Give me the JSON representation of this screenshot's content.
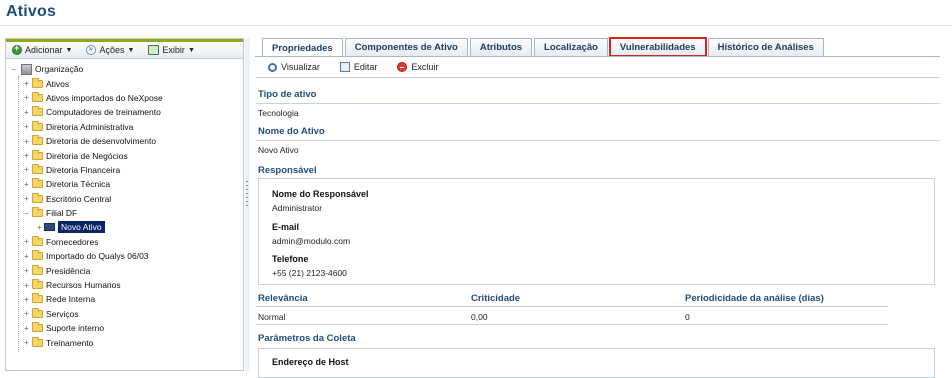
{
  "page": {
    "title": "Ativos"
  },
  "left_toolbar": {
    "add_label": "Adicionar",
    "actions_label": "Ações",
    "view_label": "Exibir"
  },
  "tree": {
    "root": "Organização",
    "items": [
      "Ativos",
      "Ativos importados do NeXpose",
      "Computadores de treinamento",
      "Diretoria Administrativa",
      "Diretoria de desenvolvimento",
      "Diretoria de Negócios",
      "Diretoria Financeira",
      "Diretoria Técnica",
      "Escritório Central",
      "Filial DF",
      "Fornecedores",
      "Importado do Qualys 06/03",
      "Presidência",
      "Recursos Humanos",
      "Rede Interna",
      "Serviços",
      "Suporte interno",
      "Treinamento"
    ],
    "selected_child": "Novo Ativo"
  },
  "tabs": [
    "Propriedades",
    "Componentes de Ativo",
    "Atributos",
    "Localização",
    "Vulnerabilidades",
    "Histórico de Análises"
  ],
  "actions": {
    "view": "Visualizar",
    "edit": "Editar",
    "delete": "Excluir"
  },
  "details": {
    "asset_type_label": "Tipo de ativo",
    "asset_type_value": "Tecnologia",
    "asset_name_label": "Nome do Ativo",
    "asset_name_value": "Novo Ativo",
    "responsible_label": "Responsável",
    "responsible_name_label": "Nome do Responsável",
    "responsible_name_value": "Administrator",
    "email_label": "E-mail",
    "email_value": "admin@modulo.com",
    "phone_label": "Telefone",
    "phone_value": "+55 (21) 2123-4600",
    "relevance_label": "Relevância",
    "relevance_value": "Normal",
    "criticality_label": "Criticidade",
    "criticality_value": "0,00",
    "periodicity_label": "Periodicidade da análise (dias)",
    "periodicity_value": "0",
    "collection_label": "Parâmetros da Coleta",
    "host_address_label": "Endereço de Host"
  },
  "colors": {
    "title": "#1f4d7a",
    "accent": "#93a91c",
    "highlight": "#e01f1f",
    "selection": "#0a246a"
  }
}
